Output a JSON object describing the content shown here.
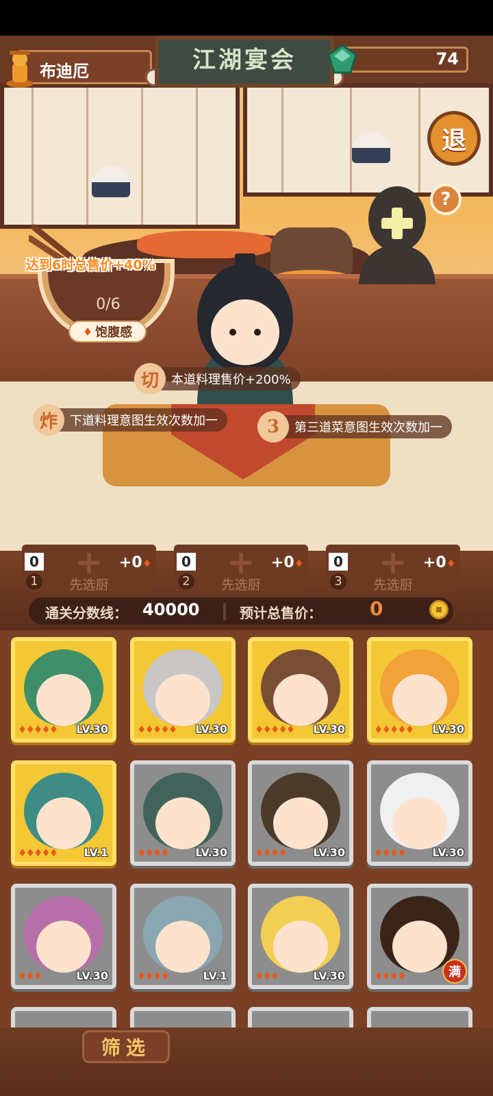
{
  "header": {
    "player_name": "布迪厄",
    "event_title": "江湖宴会",
    "gem_count": "74"
  },
  "buttons": {
    "exit_label": "退",
    "help_label": "?",
    "filter_label": "筛选"
  },
  "bowl": {
    "goal_text": "达到6时总售价+40%",
    "progress_text": "0/6",
    "satiety_label": "饱腹感",
    "progress_value": 0,
    "progress_max": 6
  },
  "intents": [
    {
      "icon_glyph": "切",
      "text": "本道料理售价+200%"
    },
    {
      "icon_glyph": "炸",
      "text": "下道料理意图生效次数加一"
    },
    {
      "icon_glyph": "3",
      "text": "第三道菜意图生效次数加一"
    }
  ],
  "slots": [
    {
      "index": "1",
      "count": "0",
      "bonus": "+0",
      "label": "先选厨"
    },
    {
      "index": "2",
      "count": "0",
      "bonus": "+0",
      "label": "先选厨"
    },
    {
      "index": "3",
      "count": "0",
      "bonus": "+0",
      "label": "先选厨"
    }
  ],
  "score": {
    "threshold_label": "通关分数线：",
    "threshold_value": "40000",
    "estimate_label": "预计总售价：",
    "estimate_value": "0"
  },
  "roster": [
    {
      "level": "LV.30",
      "stars": 5,
      "frame": "gold",
      "color": "#3f8f6a",
      "full": false
    },
    {
      "level": "LV.30",
      "stars": 5,
      "frame": "gold",
      "color": "#c9c6c6",
      "full": false
    },
    {
      "level": "LV.30",
      "stars": 5,
      "frame": "gold",
      "color": "#7a4e34",
      "full": false
    },
    {
      "level": "LV.30",
      "stars": 5,
      "frame": "gold",
      "color": "#f1a238",
      "full": false
    },
    {
      "level": "LV.1",
      "stars": 5,
      "frame": "gold",
      "color": "#3e8c84",
      "full": false
    },
    {
      "level": "LV.30",
      "stars": 4,
      "frame": "silver",
      "color": "#41635c",
      "full": false
    },
    {
      "level": "LV.30",
      "stars": 4,
      "frame": "silver",
      "color": "#4b3a2a",
      "full": false
    },
    {
      "level": "LV.30",
      "stars": 4,
      "frame": "silver",
      "color": "#f0f0f0",
      "full": false
    },
    {
      "level": "LV.30",
      "stars": 3,
      "frame": "silver",
      "color": "#b66fa8",
      "full": false
    },
    {
      "level": "LV.1",
      "stars": 4,
      "frame": "silver",
      "color": "#8aa6b0",
      "full": false
    },
    {
      "level": "LV.30",
      "stars": 3,
      "frame": "silver",
      "color": "#f2cf54",
      "full": false
    },
    {
      "level": "满",
      "stars": 4,
      "frame": "silver",
      "color": "#3a2418",
      "full": true
    }
  ],
  "colors": {
    "accent_orange": "#e98a3c",
    "flame": "#e8591a",
    "gold_frame": "#f4c734",
    "silver_frame": "#8d8d8d"
  }
}
